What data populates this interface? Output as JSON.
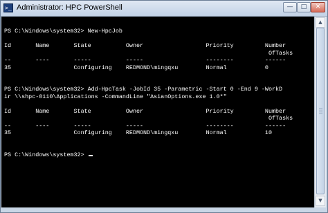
{
  "window": {
    "title": "Administrator: HPC PowerShell",
    "title_icon_glyph": ">_",
    "controls": {
      "minimize_glyph": "—",
      "maximize_glyph": "□",
      "close_glyph": "✕"
    }
  },
  "console": {
    "text": "PS C:\\Windows\\system32> New-HpcJob\n\nId       Name       State          Owner                  Priority         Number\n                                                                            OfTasks\n--       ----       -----          -----                  --------         ------\n35                  Configuring    REDMOND\\mingqxu        Normal           0\n\n\nPS C:\\Windows\\system32> Add-HpcTask -JobId 35 -Parametric -Start 0 -End 9 -WorkD\nir \\\\shpc-0110\\Applications -CommandLine \"AsianOptions.exe 1.0*\"\n\nId       Name       State          Owner                  Priority         Number\n                                                                            OfTasks\n--       ----       -----          -----                  --------         ------\n35                  Configuring    REDMOND\\mingqxu        Normal           10\n\n\nPS C:\\Windows\\system32> ",
    "colors": {
      "background": "#000000",
      "foreground": "#ffffff"
    }
  },
  "scrollbar": {
    "up_glyph": "▲",
    "down_glyph": "▼"
  }
}
